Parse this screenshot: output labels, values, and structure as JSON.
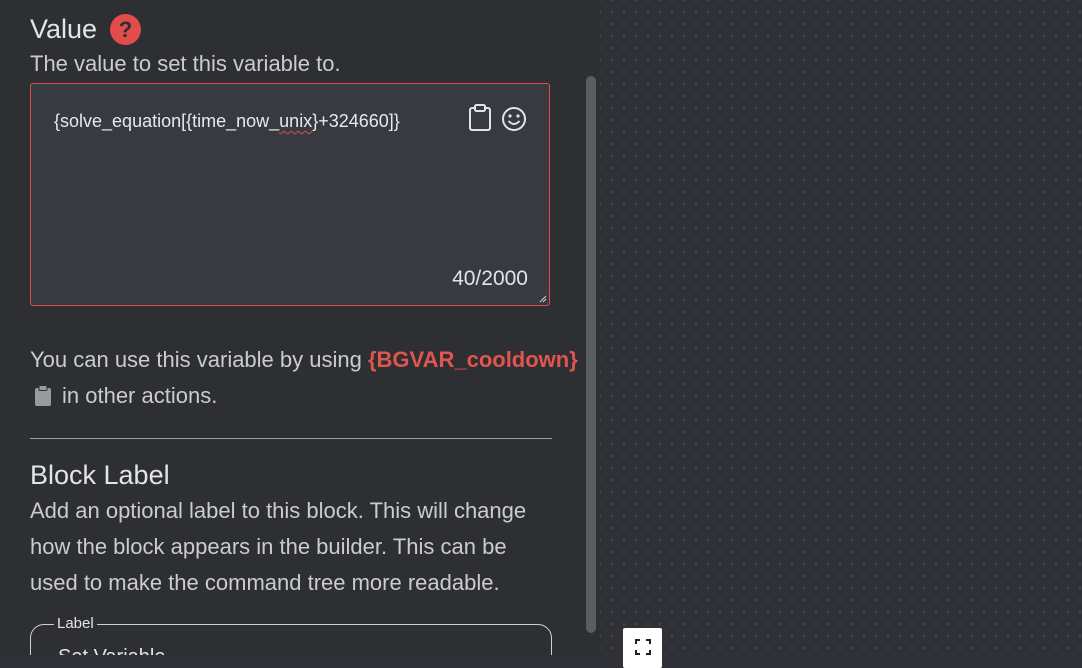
{
  "value_section": {
    "title": "Value",
    "help_icon_glyph": "?",
    "description": "The value to set this variable to.",
    "textarea": {
      "value_prefix": "{solve_equation[{time_now_",
      "value_misspelled": "unix",
      "value_suffix": "}+324660]}",
      "counter": "40/2000"
    }
  },
  "usage": {
    "text_before": "You can use this variable by using ",
    "variable_token": "{BGVAR_cooldown}",
    "text_after": "in other actions."
  },
  "block_label_section": {
    "title": "Block Label",
    "description_lines": [
      "Add an optional label to this block. This will change",
      "how the block appears in the builder. This can be",
      "used to make the command tree more readable."
    ],
    "field_legend": "Label",
    "field_value": "Set Variable"
  },
  "colors": {
    "accent_red": "#e24c4b",
    "panel_bg": "#2e2f33",
    "canvas_bg": "#2f3136"
  },
  "icons": [
    "question-circle-icon",
    "clipboard-icon",
    "emoji-smile-icon",
    "copy-icon",
    "fullscreen-icon"
  ]
}
